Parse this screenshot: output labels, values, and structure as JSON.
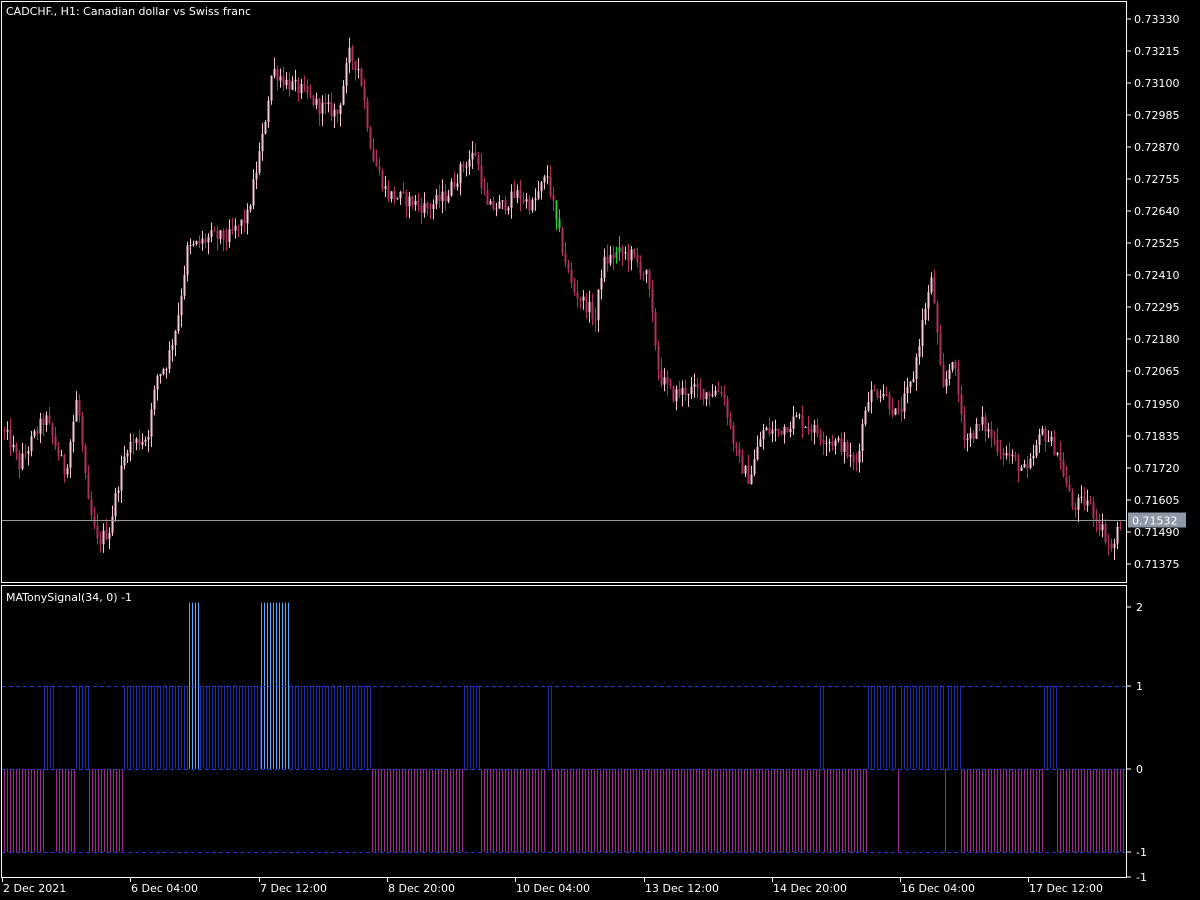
{
  "main_title": "CADCHF., H1:  Canadian dollar vs Swiss franc",
  "indicator_title": "MATonySignal(34, 0) -1",
  "price_ticks": [
    "0.73330",
    "0.73215",
    "0.73100",
    "0.72985",
    "0.72870",
    "0.72755",
    "0.72640",
    "0.72525",
    "0.72410",
    "0.72295",
    "0.72180",
    "0.72065",
    "0.71950",
    "0.71835",
    "0.71720",
    "0.71605",
    "0.71490",
    "0.71375"
  ],
  "current_price": "0.71532",
  "indicator_ticks": [
    "2",
    "1",
    "0",
    "-1",
    "-1"
  ],
  "time_labels": [
    "2 Dec 2021",
    "6 Dec 04:00",
    "7 Dec 12:00",
    "8 Dec 20:00",
    "10 Dec 04:00",
    "13 Dec 12:00",
    "14 Dec 20:00",
    "16 Dec 04:00",
    "17 Dec 12:00"
  ],
  "colors": {
    "background": "#000000",
    "frame": "#ffffff",
    "bull_candle": "#f5c6d3",
    "bear_candle": "#b0315f",
    "bull_candle_alt": "#2ecc40",
    "bid_line": "#9a9a9a",
    "price_tag": "#8c98a6",
    "level_line": "#1e3cc8",
    "hist_up": "#1a2fb0",
    "hist_strong": "#5aa7ff",
    "hist_down": "#9a2a8c"
  },
  "chart_data": [
    {
      "type": "candlestick",
      "symbol": "CADCHF.",
      "timeframe": "H1",
      "title": "CADCHF., H1:  Canadian dollar vs Swiss franc",
      "ylim": [
        0.7131,
        0.7339
      ],
      "bid": 0.71532,
      "price_path": [
        [
          0,
          0.7187
        ],
        [
          12,
          0.7182
        ],
        [
          22,
          0.7173
        ],
        [
          38,
          0.7184
        ],
        [
          48,
          0.719
        ],
        [
          58,
          0.718
        ],
        [
          68,
          0.717
        ],
        [
          80,
          0.7198
        ],
        [
          90,
          0.716
        ],
        [
          100,
          0.7145
        ],
        [
          112,
          0.715
        ],
        [
          120,
          0.7165
        ],
        [
          130,
          0.718
        ],
        [
          150,
          0.7183
        ],
        [
          160,
          0.7205
        ],
        [
          170,
          0.721
        ],
        [
          180,
          0.7225
        ],
        [
          190,
          0.725
        ],
        [
          205,
          0.7253
        ],
        [
          215,
          0.7255
        ],
        [
          230,
          0.7254
        ],
        [
          250,
          0.7262
        ],
        [
          265,
          0.729
        ],
        [
          275,
          0.7315
        ],
        [
          290,
          0.731
        ],
        [
          305,
          0.7307
        ],
        [
          320,
          0.7302
        ],
        [
          340,
          0.7299
        ],
        [
          352,
          0.732
        ],
        [
          362,
          0.7315
        ],
        [
          375,
          0.7284
        ],
        [
          390,
          0.727
        ],
        [
          410,
          0.7268
        ],
        [
          430,
          0.7265
        ],
        [
          450,
          0.727
        ],
        [
          465,
          0.728
        ],
        [
          478,
          0.7285
        ],
        [
          490,
          0.7265
        ],
        [
          505,
          0.7266
        ],
        [
          520,
          0.727
        ],
        [
          535,
          0.7266
        ],
        [
          550,
          0.7277
        ],
        [
          560,
          0.7258
        ],
        [
          575,
          0.7236
        ],
        [
          590,
          0.723
        ],
        [
          598,
          0.7225
        ],
        [
          605,
          0.7245
        ],
        [
          620,
          0.7249
        ],
        [
          635,
          0.7248
        ],
        [
          650,
          0.724
        ],
        [
          662,
          0.7205
        ],
        [
          675,
          0.7198
        ],
        [
          690,
          0.72
        ],
        [
          710,
          0.7199
        ],
        [
          725,
          0.72
        ],
        [
          740,
          0.7175
        ],
        [
          752,
          0.7168
        ],
        [
          765,
          0.7185
        ],
        [
          780,
          0.7185
        ],
        [
          800,
          0.719
        ],
        [
          815,
          0.7186
        ],
        [
          830,
          0.7182
        ],
        [
          845,
          0.718
        ],
        [
          858,
          0.7172
        ],
        [
          870,
          0.7198
        ],
        [
          885,
          0.72
        ],
        [
          900,
          0.719
        ],
        [
          915,
          0.7203
        ],
        [
          928,
          0.723
        ],
        [
          935,
          0.724
        ],
        [
          945,
          0.7198
        ],
        [
          955,
          0.7212
        ],
        [
          968,
          0.7182
        ],
        [
          985,
          0.7188
        ],
        [
          1000,
          0.718
        ],
        [
          1015,
          0.7175
        ],
        [
          1030,
          0.717
        ],
        [
          1045,
          0.7185
        ],
        [
          1060,
          0.7178
        ],
        [
          1075,
          0.7158
        ],
        [
          1090,
          0.716
        ],
        [
          1105,
          0.715
        ],
        [
          1115,
          0.7142
        ],
        [
          1122,
          0.7152
        ]
      ]
    },
    {
      "type": "bar",
      "title": "MATonySignal(34, 0) -1",
      "ylim": [
        -1.3,
        2.2
      ],
      "levels": [
        1,
        0,
        -1
      ],
      "segments": [
        {
          "from": 4,
          "to": 43,
          "value": -1
        },
        {
          "from": 44,
          "to": 55,
          "value": 1
        },
        {
          "from": 56,
          "to": 74,
          "value": -1
        },
        {
          "from": 76,
          "to": 88,
          "value": 1
        },
        {
          "from": 89,
          "to": 123,
          "value": -1
        },
        {
          "from": 124,
          "to": 188,
          "value": 1
        },
        {
          "from": 189,
          "to": 199,
          "value": 2
        },
        {
          "from": 200,
          "to": 260,
          "value": 1
        },
        {
          "from": 261,
          "to": 288,
          "value": 2
        },
        {
          "from": 289,
          "to": 371,
          "value": 1
        },
        {
          "from": 372,
          "to": 463,
          "value": -1
        },
        {
          "from": 464,
          "to": 480,
          "value": 1
        },
        {
          "from": 481,
          "to": 546,
          "value": -1
        },
        {
          "from": 548,
          "to": 551,
          "value": 1
        },
        {
          "from": 552,
          "to": 819,
          "value": -1
        },
        {
          "from": 820,
          "to": 823,
          "value": 1
        },
        {
          "from": 824,
          "to": 867,
          "value": -1
        },
        {
          "from": 868,
          "to": 897,
          "value": 1
        },
        {
          "from": 898,
          "to": 900,
          "value": -1
        },
        {
          "from": 901,
          "to": 944,
          "value": 1
        },
        {
          "from": 945,
          "to": 947,
          "value": -1
        },
        {
          "from": 948,
          "to": 960,
          "value": 1
        },
        {
          "from": 961,
          "to": 1042,
          "value": -1
        },
        {
          "from": 1044,
          "to": 1056,
          "value": 1
        },
        {
          "from": 1057,
          "to": 1123,
          "value": -1
        }
      ]
    }
  ]
}
